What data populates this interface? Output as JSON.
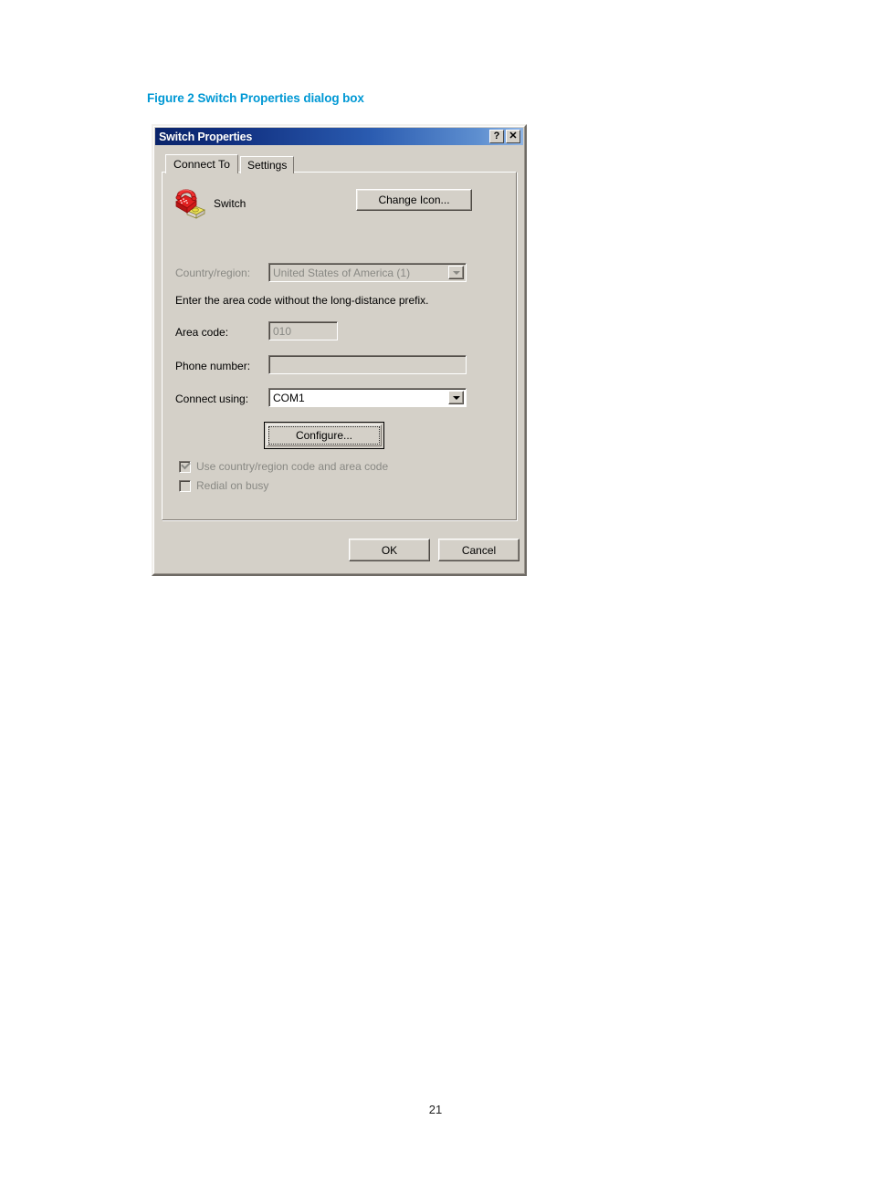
{
  "figure": {
    "caption": "Figure 2 Switch Properties dialog box",
    "caption_color": "#0098d4"
  },
  "page": {
    "number": "21"
  },
  "dialog": {
    "title": "Switch Properties",
    "titlebar_buttons": {
      "help": "?",
      "close": "✕"
    },
    "tabs": [
      {
        "label": "Connect To",
        "active": true
      },
      {
        "label": "Settings",
        "active": false
      }
    ],
    "device": {
      "name": "Switch",
      "icon": "telephone-icon",
      "change_icon_button": "Change Icon..."
    },
    "fields": {
      "country_label": "Country/region:",
      "country_value": "United States of America (1)",
      "country_disabled": true,
      "hint": "Enter the area code without the long-distance prefix.",
      "area_code_label": "Area code:",
      "area_code_value": "010",
      "area_code_disabled": true,
      "phone_number_label": "Phone number:",
      "phone_number_value": "",
      "phone_number_disabled": true,
      "connect_using_label": "Connect using:",
      "connect_using_value": "COM1",
      "connect_using_disabled": false,
      "configure_button": "Configure..."
    },
    "checkboxes": [
      {
        "label": "Use country/region code and area code",
        "checked": true,
        "disabled": true
      },
      {
        "label": "Redial on busy",
        "checked": false,
        "disabled": true
      }
    ],
    "footer": {
      "ok": "OK",
      "cancel": "Cancel"
    }
  }
}
